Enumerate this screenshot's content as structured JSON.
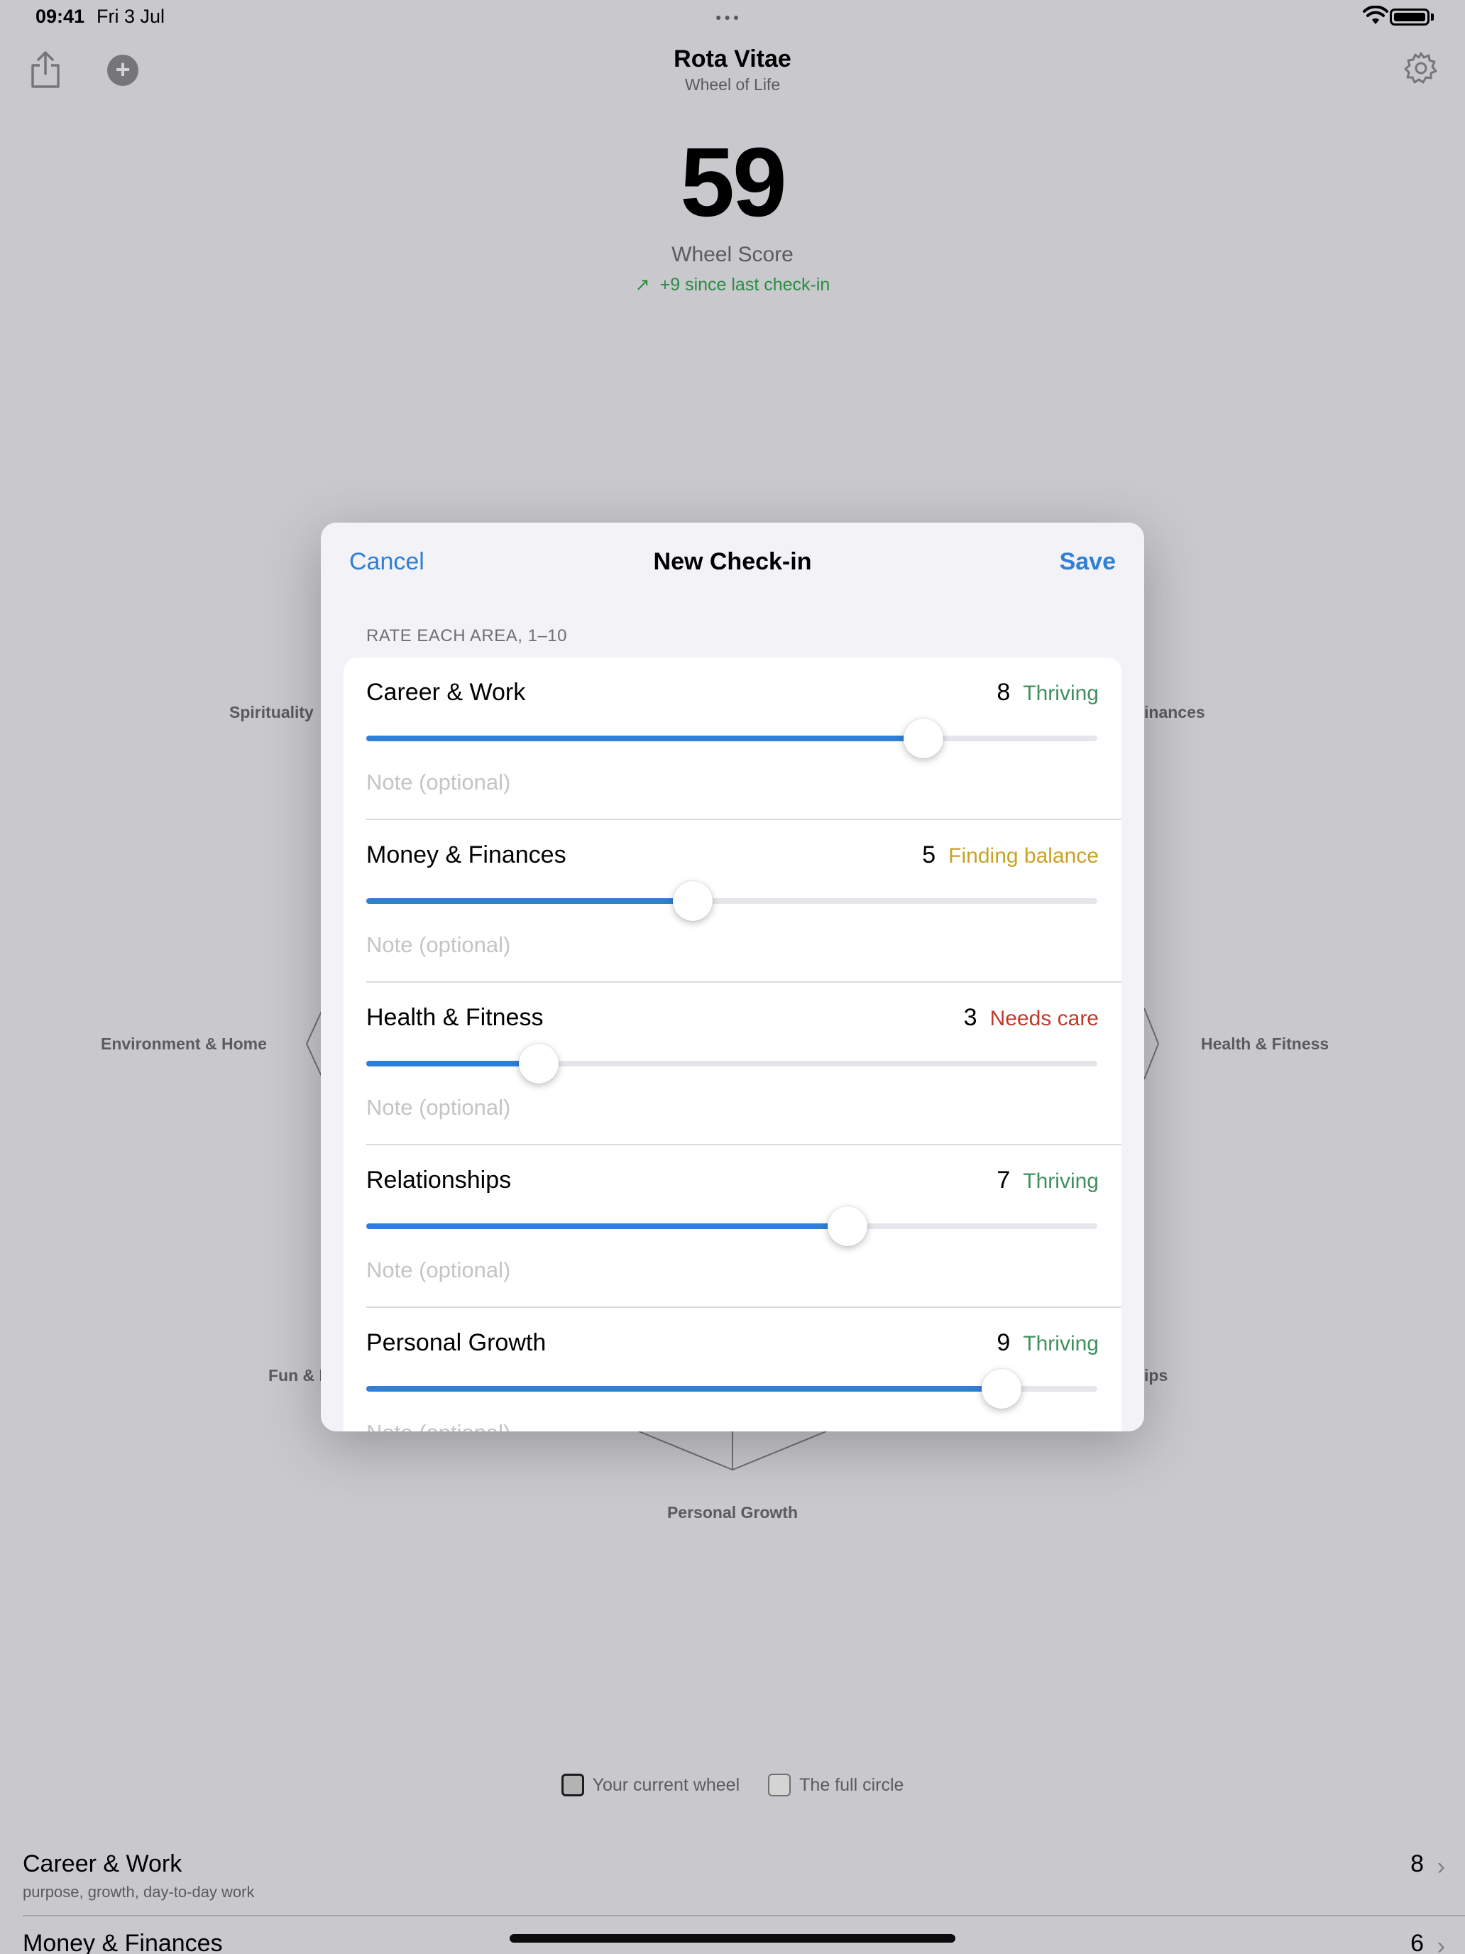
{
  "status_bar": {
    "time": "09:41",
    "date": "Fri 3 Jul"
  },
  "header": {
    "title": "Rota Vitae",
    "subtitle": "Wheel of Life",
    "share_icon": "share-icon",
    "add_icon": "plus-circle-icon",
    "settings_icon": "gear-icon"
  },
  "score": {
    "value": "59",
    "label": "Wheel Score",
    "delta": "+9 since last check-in",
    "delta_color": "#34a853"
  },
  "wheel": {
    "labels": {
      "spirituality": "Spirituality",
      "finances": "inances",
      "environment": "Environment & Home",
      "health": "Health & Fitness",
      "fun": "Fun & R",
      "relationships": "ips",
      "growth": "Personal Growth"
    }
  },
  "legend": {
    "current": "Your current wheel",
    "full": "The full circle"
  },
  "summary_list": [
    {
      "name": "Career & Work",
      "desc": "purpose, growth, day-to-day work",
      "value": "8"
    },
    {
      "name": "Money & Finances",
      "desc": "",
      "value": "6"
    }
  ],
  "sheet": {
    "cancel": "Cancel",
    "title": "New Check-in",
    "save": "Save",
    "section_header": "RATE EACH AREA, 1–10",
    "accent": "#2f7fd6",
    "rows": [
      {
        "name": "Career & Work",
        "value": "8",
        "status": "Thriving",
        "status_color": "#3f8f5f",
        "fraction": 0.762,
        "placeholder": "Note (optional)"
      },
      {
        "name": "Money & Finances",
        "value": "5",
        "status": "Finding balance",
        "status_color": "#c9a227",
        "fraction": 0.447,
        "placeholder": "Note (optional)"
      },
      {
        "name": "Health & Fitness",
        "value": "3",
        "status": "Needs care",
        "status_color": "#c0392b",
        "fraction": 0.236,
        "placeholder": "Note (optional)"
      },
      {
        "name": "Relationships",
        "value": "7",
        "status": "Thriving",
        "status_color": "#3f8f5f",
        "fraction": 0.658,
        "placeholder": "Note (optional)"
      },
      {
        "name": "Personal Growth",
        "value": "9",
        "status": "Thriving",
        "status_color": "#3f8f5f",
        "fraction": 0.869,
        "placeholder": "Note (optional)"
      }
    ]
  }
}
